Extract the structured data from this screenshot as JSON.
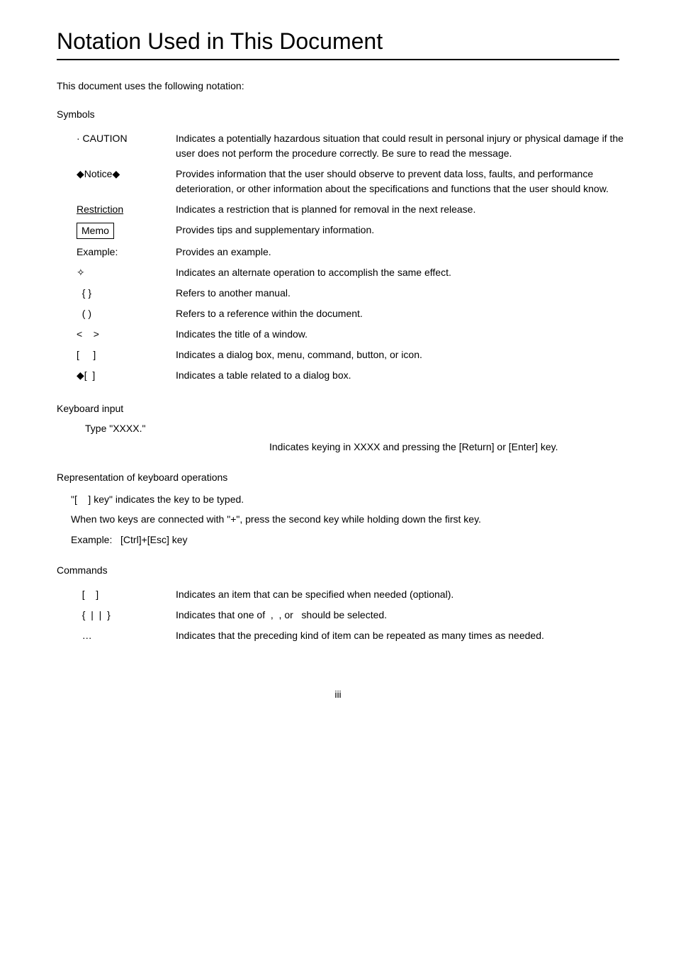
{
  "page": {
    "title": "Notation Used in This Document",
    "intro": "This document uses the following notation:",
    "footer_page": "iii"
  },
  "symbols": {
    "section_label": "Symbols",
    "rows": [
      {
        "symbol": "· CAUTION",
        "description": "Indicates a potentially hazardous situation that could result in personal injury or physical damage if the user does not perform the procedure correctly. Be sure to read the message."
      },
      {
        "symbol": "◆Notice◆",
        "description": "Provides information that the user should observe to prevent data loss, faults, and performance deterioration, or other information about the specifications and functions that the user should know."
      },
      {
        "symbol": "Restriction",
        "description": "Indicates a restriction that is planned for removal in the next release."
      },
      {
        "symbol": "Memo",
        "description": "Provides tips and supplementary information."
      },
      {
        "symbol": "Example:",
        "description": "Provides an example."
      },
      {
        "symbol": "✧",
        "description": "Indicates an alternate operation to accomplish the same effect."
      },
      {
        "symbol": "{  }",
        "description": "Refers to another manual."
      },
      {
        "symbol": "(   )",
        "description": "Refers to a reference within the document."
      },
      {
        "symbol": "<    >",
        "description": "Indicates the title of a window."
      },
      {
        "symbol": "[    ]",
        "description": "Indicates a dialog box, menu, command, button, or icon."
      },
      {
        "symbol": "◆[  ]",
        "description": "Indicates a table related to a dialog box."
      }
    ]
  },
  "keyboard_input": {
    "section_label": "Keyboard input",
    "type_line": "Type \"XXXX.\"",
    "description": "Indicates keying in XXXX and pressing the [Return] or [Enter] key."
  },
  "representation": {
    "section_label": "Representation of keyboard operations",
    "lines": [
      "\"[    ] key\" indicates the key to be typed.",
      "When two keys are connected with \"+\", press the second key while holding down the first key.",
      "Example:   [Ctrl]+[Esc] key"
    ]
  },
  "commands": {
    "section_label": "Commands",
    "rows": [
      {
        "symbol": "[    ]",
        "description": "Indicates an item that can be specified when needed (optional)."
      },
      {
        "symbol": "{  |  |  }",
        "description": "Indicates that one of  ,  , or   should be selected."
      },
      {
        "symbol": "…",
        "description": "Indicates that the preceding kind of item can be repeated as many times as needed."
      }
    ]
  }
}
